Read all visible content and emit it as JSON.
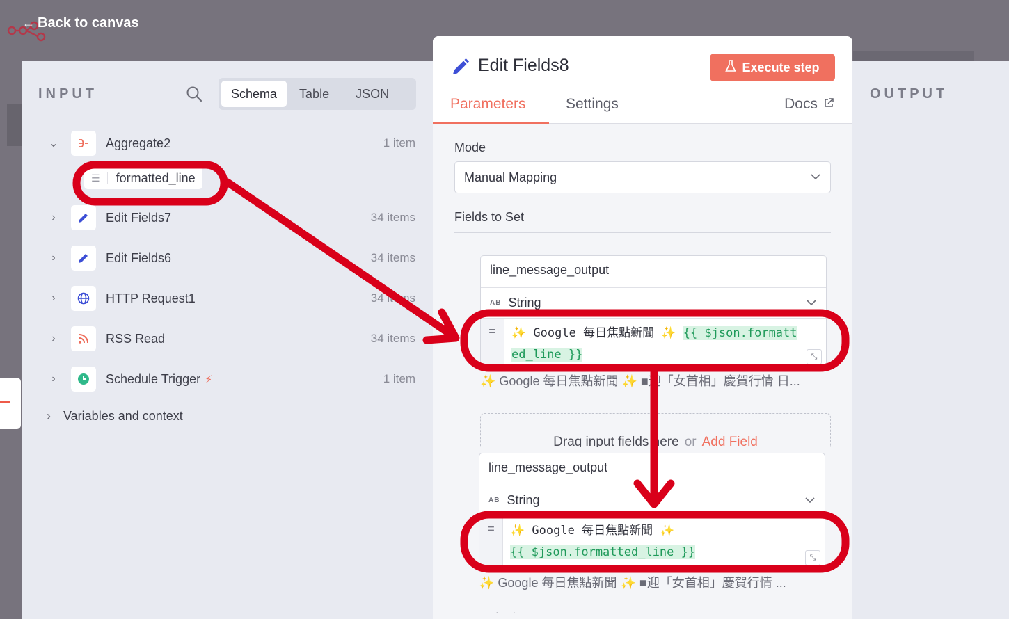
{
  "header": {
    "back_label": "Back to canvas"
  },
  "input_panel": {
    "title": "INPUT",
    "view_tabs": [
      "Schema",
      "Table",
      "JSON"
    ],
    "active_view": "Schema",
    "nodes": [
      {
        "label": "Aggregate2",
        "count": "1 item",
        "icon": "aggregate-icon",
        "expanded": true
      },
      {
        "label": "Edit Fields7",
        "count": "34 items",
        "icon": "pencil-icon"
      },
      {
        "label": "Edit Fields6",
        "count": "34 items",
        "icon": "pencil-icon"
      },
      {
        "label": "HTTP Request1",
        "count": "34 items",
        "icon": "globe-icon"
      },
      {
        "label": "RSS Read",
        "count": "34 items",
        "icon": "rss-icon"
      },
      {
        "label": "Schedule Trigger",
        "count": "1 item",
        "icon": "clock-icon"
      }
    ],
    "field": "formatted_line",
    "variables_label": "Variables and context"
  },
  "output_panel": {
    "title": "OUTPUT"
  },
  "dialog": {
    "title": "Edit Fields8",
    "execute_label": "Execute step",
    "tabs": [
      "Parameters",
      "Settings"
    ],
    "docs_label": "Docs",
    "mode_label": "Mode",
    "mode_value": "Manual Mapping",
    "fields_label": "Fields to Set",
    "cards": [
      {
        "name": "line_message_output",
        "type": "String",
        "type_badge": "AB",
        "value_text": "Google 每日焦點新聞",
        "value_expr_a": "{{ $json.formatt",
        "value_expr_b": "ed_line }}",
        "preview": "✨ Google 每日焦點新聞 ✨ ■迎「女首相」慶賀行情 日..."
      },
      {
        "name": "line_message_output",
        "type": "String",
        "type_badge": "AB",
        "value_text": "Google 每日焦點新聞",
        "value_expr": "{{ $json.formatted_line }}",
        "preview": "✨ Google 每日焦點新聞 ✨ ■迎「女首相」慶賀行情 ..."
      }
    ],
    "drop_text": "Drag input fields here",
    "drop_or": "or",
    "add_field_label": "Add Field"
  },
  "colors": {
    "accent": "#f0705f",
    "annotation": "#d9001a",
    "expression_bg": "#d8f3e3",
    "expression_fg": "#1f9a5a"
  }
}
